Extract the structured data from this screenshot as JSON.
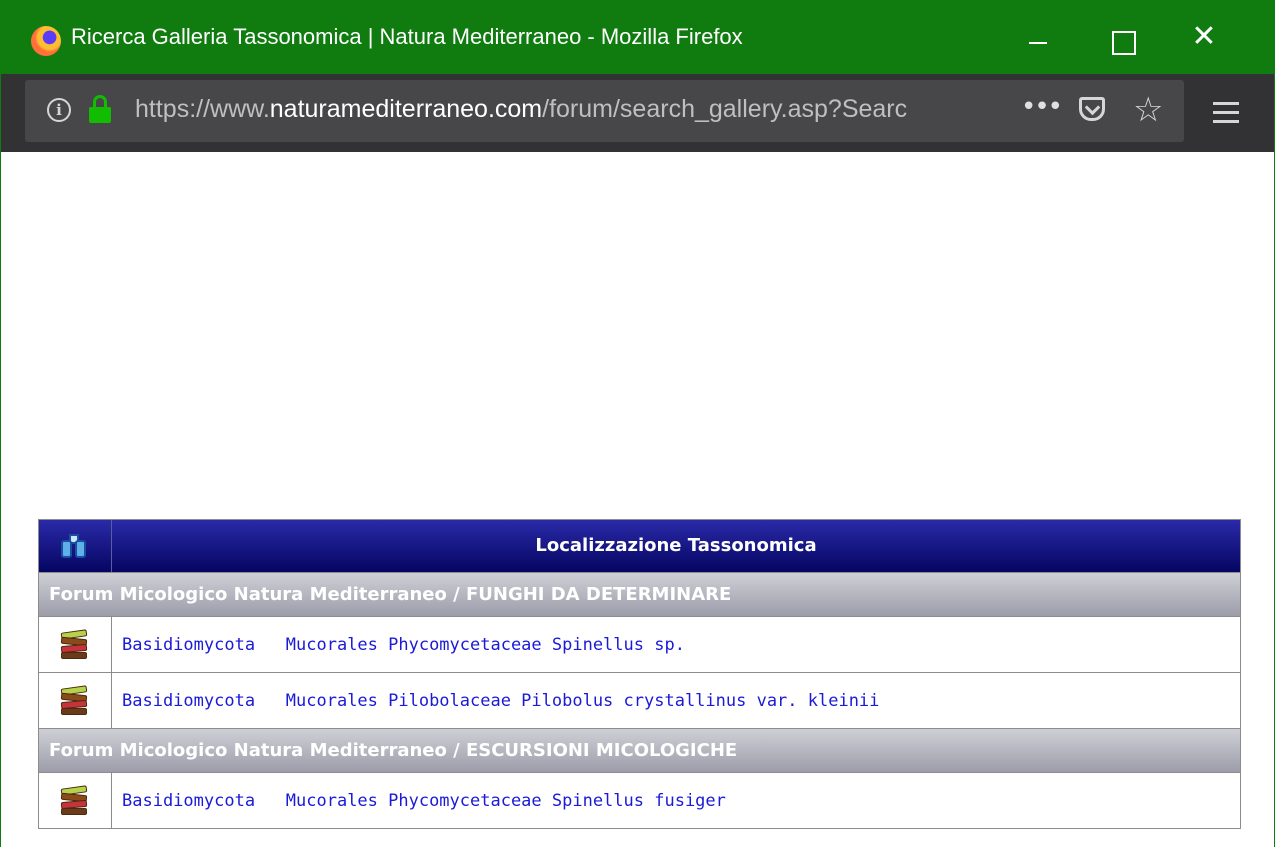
{
  "window": {
    "title": "Ricerca Galleria Tassonomica | Natura Mediterraneo - Mozilla Firefox",
    "close_glyph": "✕"
  },
  "navbar": {
    "url_prefix": "https://www.",
    "url_host": "naturamediterraneo.com",
    "url_path": "/forum/search_gallery.asp?Searc",
    "more_glyph": "•••",
    "star_glyph": "☆",
    "info_glyph": "i"
  },
  "table": {
    "header_title": "Localizzazione Tassonomica",
    "sections": [
      {
        "forum": "Forum Micologico Natura Mediterraneo / FUNGHI DA DETERMINARE",
        "items": [
          {
            "phylum": "Basidiomycota",
            "taxon": "Mucorales Phycomycetaceae Spinellus sp."
          },
          {
            "phylum": "Basidiomycota",
            "taxon": "Mucorales Pilobolaceae Pilobolus crystallinus var. kleinii"
          }
        ]
      },
      {
        "forum": "Forum Micologico Natura Mediterraneo / ESCURSIONI MICOLOGICHE",
        "items": [
          {
            "phylum": "Basidiomycota",
            "taxon": "Mucorales Phycomycetaceae Spinellus fusiger"
          }
        ]
      }
    ]
  },
  "colors": {
    "titlebar": "#107c10",
    "navbar": "#323234",
    "header": "#0a0a7a",
    "link": "#1a1ad8"
  },
  "icons": [
    "firefox-logo",
    "minimize-icon",
    "maximize-icon",
    "close-icon",
    "info-icon",
    "lock-icon",
    "more-icon",
    "pocket-icon",
    "bookmark-star-icon",
    "menu-icon",
    "binoculars-icon",
    "books-icon"
  ]
}
